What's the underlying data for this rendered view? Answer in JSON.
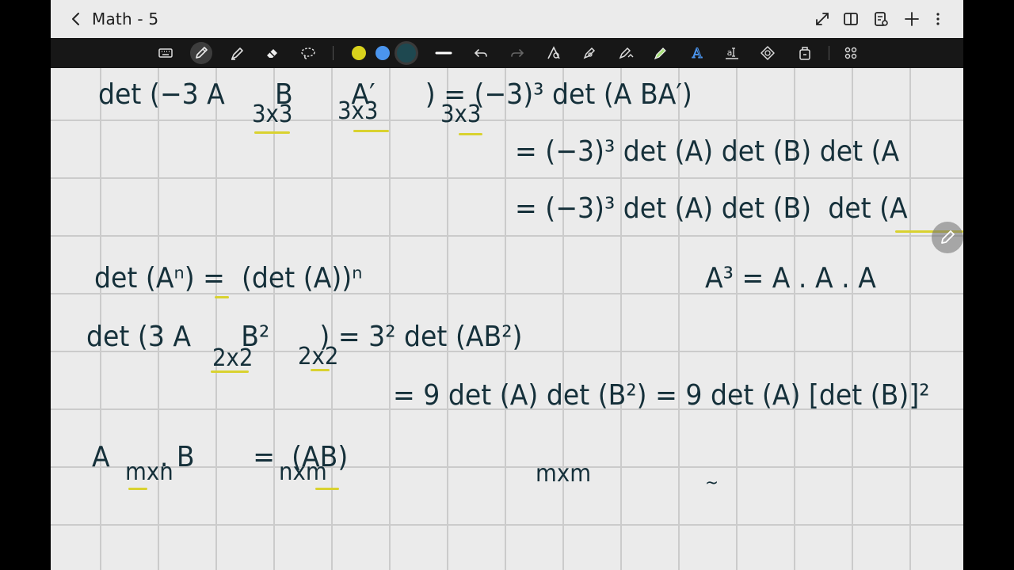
{
  "header": {
    "title": "Math - 5",
    "icons": [
      "back-icon",
      "expand-icon",
      "book-view-icon",
      "page-settings-icon",
      "add-page-icon",
      "more-options-icon"
    ]
  },
  "toolbar": {
    "tools": [
      "keyboard-icon",
      "pen-icon",
      "highlighter-icon",
      "eraser-icon",
      "lasso-icon"
    ],
    "colors": [
      "#d9d21c",
      "#4b95ee",
      "#1e4850"
    ],
    "selected_color": "#1e4850",
    "right_tools": [
      "line-icon",
      "undo-icon",
      "redo-icon",
      "shape-icon",
      "pen-settings-icon",
      "text-icon",
      "handwriting-icon",
      "text-box-icon",
      "sticker-icon",
      "image-icon",
      "grid-menu-icon"
    ]
  },
  "note": {
    "lines": [
      {
        "text": "det (−3 A  B  A′  ) = (−3)³ det (A BA′)",
        "label": "line-1"
      },
      {
        "subs": [
          "3x3",
          "3x3",
          "3x3"
        ]
      },
      {
        "text": "= (−3)³ det (A) det (B) det (A",
        "label": "line-2"
      },
      {
        "text": "= (−3)³ det (A) det (B)  det (A",
        "label": "line-3"
      },
      {
        "text": "det (Aⁿ) =  (det (A))ⁿ",
        "label": "line-4"
      },
      {
        "text": "A³ = A . A . A",
        "label": "line-5"
      },
      {
        "text": "det (3 A     B²    ) = 3² det (AB²)",
        "label": "line-6"
      },
      {
        "subs2": [
          "2x2",
          "2x2"
        ]
      },
      {
        "text": "= 9 det (A) det (B²) = 9 det (A) [det (B)]²",
        "label": "line-7"
      },
      {
        "text": "A     .  B      =  (AB)",
        "label": "line-8"
      },
      {
        "subs3": [
          "mxn",
          "nxm",
          "mxm"
        ]
      }
    ]
  }
}
